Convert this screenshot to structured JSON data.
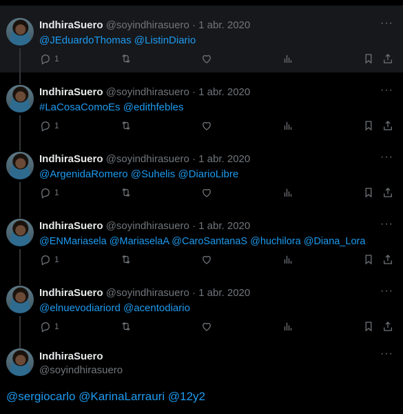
{
  "tweets": [
    {
      "name": "IndhiraSuero",
      "handle": "@soyindhirasuero",
      "sep": "·",
      "date": "1 abr. 2020",
      "mentions": [
        "@JEduardoThomas",
        "@ListinDiario"
      ],
      "reply_count": "1",
      "more": "···"
    },
    {
      "name": "IndhiraSuero",
      "handle": "@soyindhirasuero",
      "sep": "·",
      "date": "1 abr. 2020",
      "mentions": [
        "#LaCosaComoEs",
        "@edithfebles"
      ],
      "reply_count": "1",
      "more": "···"
    },
    {
      "name": "IndhiraSuero",
      "handle": "@soyindhirasuero",
      "sep": "·",
      "date": "1 abr. 2020",
      "mentions": [
        "@ArgenidaRomero",
        "@Suhelis",
        "@DiarioLibre"
      ],
      "reply_count": "1",
      "more": "···"
    },
    {
      "name": "IndhiraSuero",
      "handle": "@soyindhirasuero",
      "sep": "·",
      "date": "1 abr. 2020",
      "mentions": [
        "@ENMariasela",
        "@MariaselaA",
        "@CaroSantanaS",
        "@huchilora",
        "@Diana_Lora"
      ],
      "reply_count": "1",
      "more": "···"
    },
    {
      "name": "IndhiraSuero",
      "handle": "@soyindhirasuero",
      "sep": "·",
      "date": "1 abr. 2020",
      "mentions": [
        "@elnuevodiariord",
        "@acentodiario"
      ],
      "reply_count": "1",
      "more": "···"
    }
  ],
  "focused": {
    "name": "IndhiraSuero",
    "handle": "@soyindhirasuero",
    "more": "···",
    "mentions": [
      "@sergiocarlo",
      "@KarinaLarrauri",
      "@12y2"
    ]
  },
  "icons": [
    "reply-icon",
    "retweet-icon",
    "like-icon",
    "views-icon",
    "bookmark-icon",
    "share-icon",
    "avatar"
  ],
  "colors": {
    "background": "#000000",
    "highlight": "#16181c",
    "link": "#1d9bf0",
    "muted": "#71767b",
    "text": "#e7e9ea"
  }
}
